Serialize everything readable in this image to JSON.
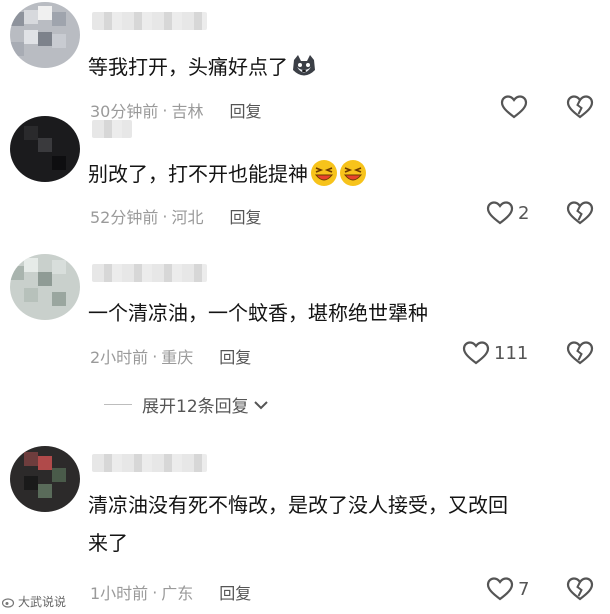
{
  "comments": [
    {
      "text": "等我打开，头痛好点了",
      "emoji": "wolf-emoji",
      "time": "30分钟前",
      "location": "吉林",
      "reply": "回复",
      "likes": ""
    },
    {
      "text": "别改了，打不开也能提神",
      "emoji": "laughing-crying-emoji",
      "time": "52分钟前",
      "location": "河北",
      "reply": "回复",
      "likes": "2"
    },
    {
      "text": "一个清凉油，一个蚊香，堪称绝世犟种",
      "time": "2小时前",
      "location": "重庆",
      "reply": "回复",
      "likes": "111"
    },
    {
      "text_line1": "清凉油没有死不悔改，是改了没人接受，又改回",
      "text_line2": "来了",
      "time": "1小时前",
      "location": "广东",
      "reply": "回复",
      "likes": "7"
    }
  ],
  "expand_replies": "展开12条回复",
  "meta_separator": "·",
  "watermark": "大武说说",
  "colors": {
    "text": "#141414",
    "meta": "#9a9a9a",
    "icon": "#555555",
    "emoji_red": "#e8432c",
    "emoji_yellow": "#f7c31b"
  }
}
